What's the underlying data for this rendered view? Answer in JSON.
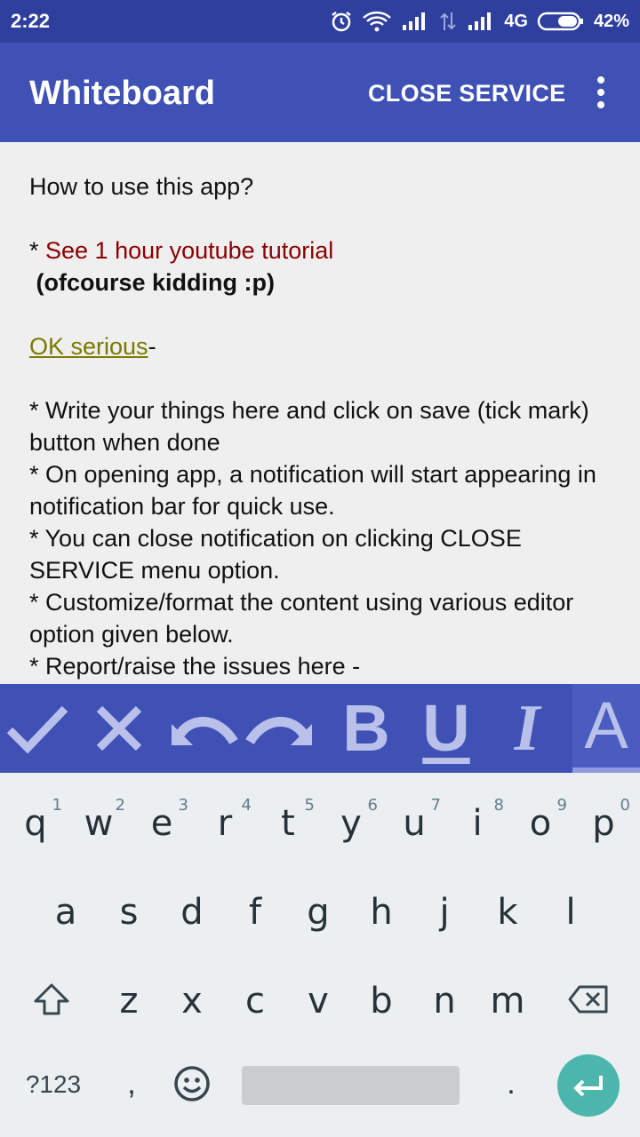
{
  "status_bar": {
    "time": "2:22",
    "network": "4G",
    "battery": "42%",
    "icons": [
      "alarm-icon",
      "wifi-icon",
      "signal-icon",
      "data-transfer-icon",
      "signal-icon",
      "battery-icon"
    ]
  },
  "app_bar": {
    "title": "Whiteboard",
    "close_service_label": "CLOSE SERVICE",
    "overflow_icon": "more-vert-icon"
  },
  "editor": {
    "line1": "How to use this app?",
    "tutorial_prefix": "* ",
    "tutorial_link": "See 1 hour youtube tutorial",
    "kidding": " (ofcourse kidding :p)",
    "ok_link": "OK serious",
    "ok_suffix": "-",
    "bullet1": "* Write your things here and click on save (tick mark) button when done",
    "bullet2": "* On opening app, a notification will start appearing in notification bar for quick use.",
    "bullet3": "* You can close notification on clicking CLOSE SERVICE menu option.",
    "bullet4": "* Customize/format the content using various editor option given below.",
    "bullet5": "* Report/raise the issues here -",
    "colors": {
      "tutorial": "#8b0000",
      "ok_link": "#7a7a00"
    }
  },
  "format_toolbar": {
    "buttons": [
      "check-icon",
      "close-icon",
      "undo-icon",
      "redo-icon",
      "bold-icon",
      "underline-icon",
      "italic-icon",
      "text-color-icon"
    ],
    "bold_glyph": "B",
    "underline_glyph": "U",
    "italic_glyph": "I",
    "color_glyph": "A",
    "active": "text-color-icon",
    "background": "#3f51b5"
  },
  "keyboard": {
    "row1": [
      {
        "ch": "q",
        "hint": "1"
      },
      {
        "ch": "w",
        "hint": "2"
      },
      {
        "ch": "e",
        "hint": "3"
      },
      {
        "ch": "r",
        "hint": "4"
      },
      {
        "ch": "t",
        "hint": "5"
      },
      {
        "ch": "y",
        "hint": "6"
      },
      {
        "ch": "u",
        "hint": "7"
      },
      {
        "ch": "i",
        "hint": "8"
      },
      {
        "ch": "o",
        "hint": "9"
      },
      {
        "ch": "p",
        "hint": "0"
      }
    ],
    "row2": [
      "a",
      "s",
      "d",
      "f",
      "g",
      "h",
      "j",
      "k",
      "l"
    ],
    "row3": [
      "z",
      "x",
      "c",
      "v",
      "b",
      "n",
      "m"
    ],
    "symbols_label": "?123",
    "comma": ",",
    "period": ".",
    "enter_color": "#4db6ac"
  }
}
